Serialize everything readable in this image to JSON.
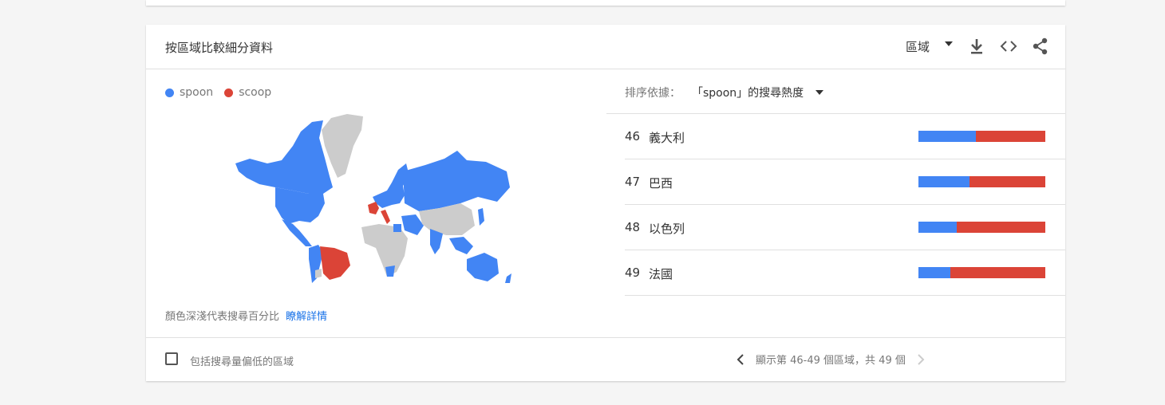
{
  "card": {
    "title": "按區域比較細分資料",
    "region_select": "區域",
    "icons": [
      "download-icon",
      "embed-code-icon",
      "share-icon"
    ]
  },
  "legend": [
    {
      "label": "spoon",
      "color": "#4285f4"
    },
    {
      "label": "scoop",
      "color": "#db4437"
    }
  ],
  "note": {
    "text": "顏色深淺代表搜尋百分比",
    "link": "瞭解詳情"
  },
  "sort": {
    "label": "排序依據：",
    "value": "「spoon」的搜尋熱度"
  },
  "rows": [
    {
      "rank": "46",
      "name": "義大利",
      "spoon_share": 0.45
    },
    {
      "rank": "47",
      "name": "巴西",
      "spoon_share": 0.4
    },
    {
      "rank": "48",
      "name": "以色列",
      "spoon_share": 0.3
    },
    {
      "rank": "49",
      "name": "法國",
      "spoon_share": 0.25
    }
  ],
  "footer": {
    "checkbox_label": "包括搜尋量偏低的區域",
    "pager_text": "顯示第 46-49 個區域，共 49 個"
  },
  "colors": {
    "spoon": "#4285f4",
    "scoop": "#db4437",
    "no_data": "#cccccc",
    "link": "#1a73e8"
  }
}
